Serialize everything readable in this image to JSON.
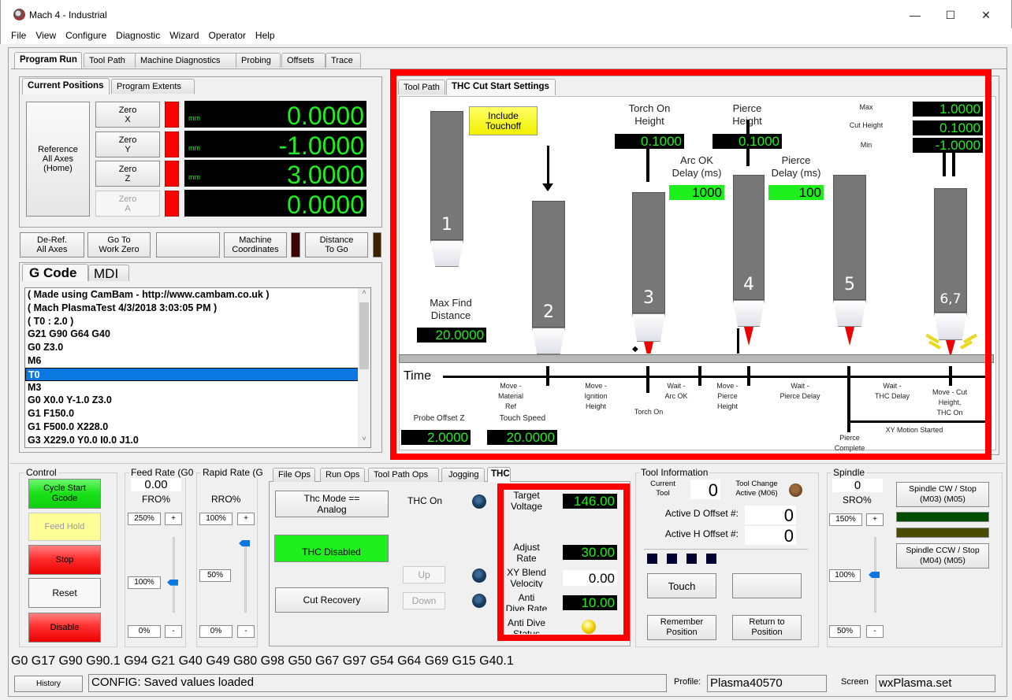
{
  "window": {
    "title": "Mach 4 - Industrial",
    "controls": {
      "minimize": "—",
      "maximize": "☐",
      "close": "✕"
    }
  },
  "menu": [
    "File",
    "View",
    "Configure",
    "Diagnostic",
    "Wizard",
    "Operator",
    "Help"
  ],
  "main_tabs": [
    "Program Run",
    "Tool Path",
    "Machine Diagnostics",
    "Probing",
    "Offsets",
    "Trace"
  ],
  "positions": {
    "tabs": [
      "Current Positions",
      "Program Extents"
    ],
    "reference_all": "Reference\nAll Axes\n(Home)",
    "axes": [
      {
        "zero_label": "Zero\nX",
        "value": "0.0000",
        "unit": "mm",
        "enabled": true
      },
      {
        "zero_label": "Zero\nY",
        "value": "-1.0000",
        "unit": "mm",
        "enabled": true
      },
      {
        "zero_label": "Zero\nZ",
        "value": "3.0000",
        "unit": "mm",
        "enabled": true
      },
      {
        "zero_label": "Zero\nA",
        "value": "0.0000",
        "unit": "",
        "enabled": false
      }
    ],
    "buttons": {
      "deref": "De-Ref.\nAll Axes",
      "goto_zero": "Go To\nWork Zero",
      "blank": "",
      "machine_coords": "Machine\nCoordinates",
      "dist_to_go": "Distance\nTo Go"
    }
  },
  "gcode": {
    "tabs": [
      "G Code",
      "MDI"
    ],
    "lines": [
      "( Made using CamBam - http://www.cambam.co.uk )",
      "( Mach  PlasmaTest 4/3/2018 3:03:05 PM )",
      "( T0 : 2.0 )",
      "G21 G90 G64 G40",
      "G0 Z3.0",
      "M6",
      "T0",
      "M3",
      "G0 X0.0 Y-1.0 Z3.0",
      "G1 F150.0",
      "G1 F500.0 X228.0",
      "G3 X229.0 Y0.0 I0.0 J1.0"
    ],
    "selected_index": 6
  },
  "thc_panel": {
    "tabs": [
      "Tool Path",
      "THC Cut Start Settings"
    ],
    "include_touchoff": "Include\nTouchoff",
    "torch_on_height_label": "Torch On\nHeight",
    "torch_on_height": "0.1000",
    "pierce_height_label": "Pierce\nHeight",
    "pierce_height": "0.1000",
    "arc_ok_delay_label": "Arc OK\nDelay (ms)",
    "arc_ok_delay": "1000",
    "pierce_delay_label": "Pierce\nDelay (ms)",
    "pierce_delay": "100",
    "max_label": "Max",
    "max": "1.0000",
    "cut_height_label": "Cut Height",
    "cut_height": "0.1000",
    "min_label": "Min",
    "min": "-1.0000",
    "max_find_label": "Max Find\nDistance",
    "max_find": "20.0000",
    "torch_numbers": [
      "1",
      "2",
      "3",
      "4",
      "5",
      "6,7"
    ],
    "time_label": "Time",
    "timeline_labels": [
      "Move -\nMaterial\nRef",
      "Move -\nIgnition\nHeight",
      "Torch On",
      "Wait -\nArc OK",
      "Move -\nPierce\nHeight",
      "Wait -\nPierce Delay",
      "Pierce\nComplete",
      "Wait -\nTHC Delay",
      "Move -  Cut\nHeight,\nTHC On",
      "XY Motion Started"
    ],
    "probe_offset_label": "Probe Offset Z",
    "probe_offset": "2.0000",
    "touch_speed_label": "Touch Speed",
    "touch_speed": "20.0000"
  },
  "control": {
    "group": "Control",
    "cycle_start": "Cycle Start\nGcode",
    "feed_hold": "Feed Hold",
    "stop": "Stop",
    "reset": "Reset",
    "disable": "Disable"
  },
  "feed_rate": {
    "group": "Feed Rate (G0",
    "value": "0.00",
    "label": "FRO%",
    "max": "250%",
    "mid": "100%",
    "min": "0%",
    "plus": "+",
    "minus": "-",
    "override_percent": 100
  },
  "rapid_rate": {
    "group": "Rapid Rate (G",
    "label": "RRO%",
    "max": "100%",
    "mid": "50%",
    "min": "0%",
    "plus": "+",
    "minus": "-",
    "override_percent": 100
  },
  "ops_tabs": [
    "File Ops",
    "Run Ops",
    "Tool Path Ops",
    "Jogging",
    "THC"
  ],
  "thc_ops": {
    "mode": "Thc Mode ==\nAnalog",
    "thc_on": "THC On",
    "thc_disabled": "THC Disabled",
    "up": "Up",
    "down": "Down",
    "cut_recovery": "Cut Recovery",
    "target_voltage_label": "Target\nVoltage",
    "target_voltage": "146.00",
    "adjust_rate_label": "Adjust\nRate",
    "adjust_rate": "30.00",
    "xy_blend_label": "XY Blend\nVelocity",
    "xy_blend": "0.00",
    "anti_dive_rate_label": "Anti\nDive Rate",
    "anti_dive_rate": "10.00",
    "anti_dive_status_label": "Anti Dive\nStatus"
  },
  "tool_info": {
    "group": "Tool Information",
    "current_tool_label": "Current\nTool",
    "current_tool": "0",
    "tool_change_label": "Tool Change\nActive (M06)",
    "d_offset_label": "Active D Offset #:",
    "d_offset": "0",
    "h_offset_label": "Active H Offset #:",
    "h_offset": "0",
    "touch": "Touch",
    "blank": "",
    "remember": "Remember\nPosition",
    "return": "Return to\nPosition"
  },
  "spindle": {
    "group": "Spindle",
    "value": "0",
    "label": "SRO%",
    "max": "150%",
    "mid": "100%",
    "min": "50%",
    "plus": "+",
    "minus": "-",
    "cw": "Spindle CW / Stop\n(M03)          (M05)",
    "ccw": "Spindle CCW / Stop\n(M04)          (M05)",
    "override_percent": 100
  },
  "modal_line": "G0 G17 G90 G90.1 G94 G21 G40 G49 G80 G98 G50 G67 G97 G54 G64 G69 G15 G40.1",
  "status": {
    "history": "History",
    "message": "CONFIG: Saved values loaded",
    "profile_label": "Profile:",
    "profile": "Plasma40570",
    "screen_label": "Screen",
    "screen": "wxPlasma.set"
  },
  "colors": {
    "dro_green": "#1ef01e",
    "highlight_red": "#ff0000",
    "selection_blue": "#0a78e0"
  }
}
